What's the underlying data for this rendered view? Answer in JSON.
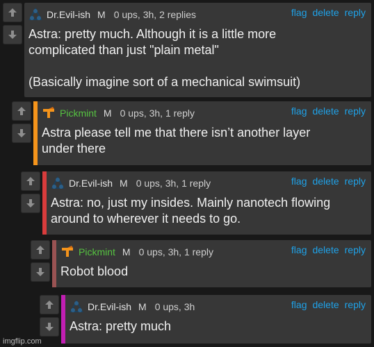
{
  "comments": [
    {
      "user": "Dr.Evil-ish",
      "mod": "M",
      "stats": "0 ups, 3h, 2 replies",
      "text": "Astra: pretty much. Although it is a little more\ncomplicated than just \"plain metal\"\n\n(Basically imagine sort of a mechanical swimsuit)",
      "actions": {
        "flag": "flag",
        "delete": "delete",
        "reply": "reply"
      }
    },
    {
      "user": "Pickmint",
      "mod": "M",
      "stats": "0 ups, 3h, 1 reply",
      "text": "Astra please tell me that there isn’t another layer\nunder there",
      "actions": {
        "flag": "flag",
        "delete": "delete",
        "reply": "reply"
      }
    },
    {
      "user": "Dr.Evil-ish",
      "mod": "M",
      "stats": "0 ups, 3h, 1 reply",
      "text": "Astra: no, just my insides. Mainly nanotech flowing\naround to wherever it needs to go.",
      "actions": {
        "flag": "flag",
        "delete": "delete",
        "reply": "reply"
      }
    },
    {
      "user": "Pickmint",
      "mod": "M",
      "stats": "0 ups, 3h, 1 reply",
      "text": "Robot blood",
      "actions": {
        "flag": "flag",
        "delete": "delete",
        "reply": "reply"
      }
    },
    {
      "user": "Dr.Evil-ish",
      "mod": "M",
      "stats": "0 ups, 3h",
      "text": "Astra: pretty much",
      "actions": {
        "flag": "flag",
        "delete": "delete",
        "reply": "reply"
      }
    }
  ],
  "colors": {
    "orange": "#f5941b",
    "red": "#d93c3c",
    "rose": "#9a5353",
    "magenta": "#c21fb3",
    "link": "#1fa2e8",
    "pickmint_name": "#56c341"
  },
  "watermark": "imgflip.com"
}
